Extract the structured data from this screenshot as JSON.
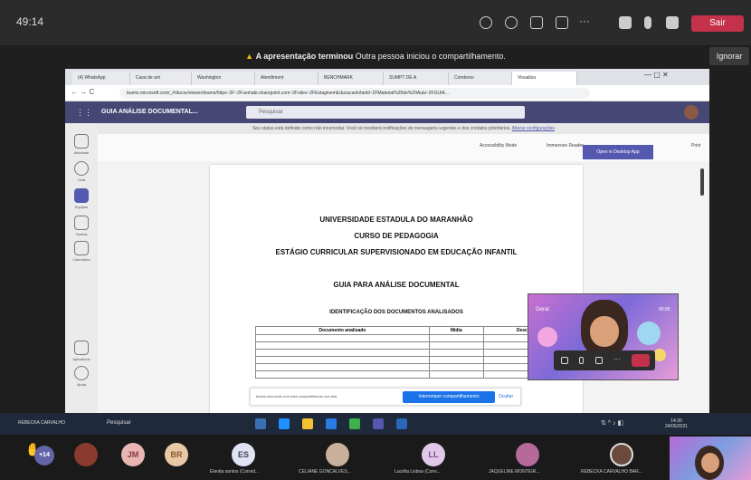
{
  "teams_bar": {
    "timer": "49:14",
    "leave_label": "Sair"
  },
  "banner": {
    "bold": "A apresentação terminou",
    "rest": "Outra pessoa iniciou o compartilhamento.",
    "ignore_label": "Ignorar"
  },
  "browser": {
    "tabs": [
      "(4) WhatsApp",
      "Casa de arri",
      "Washington",
      "Atendiment",
      "BENCHMARK",
      "SUMPT DE A",
      "Conderso",
      "Visualiza"
    ],
    "url": "teams.microsoft.com/_#/docsv/viewer/teams/https~2F~2Fuemabr.sharepoint.com~2Fsites~2FEstagioemEducacaoInfantil~2FMaterial%20de%20Aula~2FGUIA..."
  },
  "teams_app": {
    "title": "GUIA ANÁLISE DOCUMENTAL...",
    "search_placeholder": "Pesquisar",
    "rail": [
      "Atividade",
      "Chat",
      "Equipes",
      "Tarefas",
      "Calendário",
      "Aplicativos",
      "Ajuda"
    ],
    "notice": "Seu status está definido como não incomodar. Você só receberá notificações de mensagens urgentes e dos contatos prioritários.",
    "notice_link": "Alterar configurações",
    "tools": {
      "accessibility": "Accessibility Mode",
      "immersive": "Immersive Reader",
      "desktop": "Open in Desktop App",
      "print": "Print"
    }
  },
  "document": {
    "line1": "UNIVERSIDADE ESTADULA DO MARANHÃO",
    "line2": "CURSO DE PEDAGOGIA",
    "line3": "ESTÁGIO CURRICULAR SUPERVISIONADO EM EDUCAÇÃO INFANTIL",
    "line4": "GUIA PARA ANÁLISE DOCUMENTAL",
    "section": "IDENTIFICAÇÃO DOS DOCUMENTOS ANALISADOS",
    "table_headers": [
      "Documento analisado",
      "Mídia",
      "Descrição"
    ]
  },
  "share_bar": {
    "message": "teams.microsoft.com está compartilhando sua tela.",
    "stop": "Interromper compartilhamento",
    "hide": "Ocultar"
  },
  "video": {
    "name": "Geral",
    "time": "00:05"
  },
  "taskbar": {
    "user": "REBECKA CARVALHO",
    "search": "Pesquisar",
    "time": "14:30",
    "date": "24/05/2021"
  },
  "participants": [
    {
      "initials": "+14",
      "name": ""
    },
    {
      "initials": "JM",
      "name": ""
    },
    {
      "initials": "BR",
      "name": ""
    },
    {
      "initials": "ES",
      "name": "Elenita santos (Convid..."
    },
    {
      "initials": "",
      "name": "CELIANE GONCALVES..."
    },
    {
      "initials": "LL",
      "name": "Lucélia Lisboa (Conv..."
    },
    {
      "initials": "",
      "name": "JAQUELINE MONTEIR..."
    },
    {
      "initials": "",
      "name": "REBECKA CARVALHO BAR..."
    }
  ]
}
